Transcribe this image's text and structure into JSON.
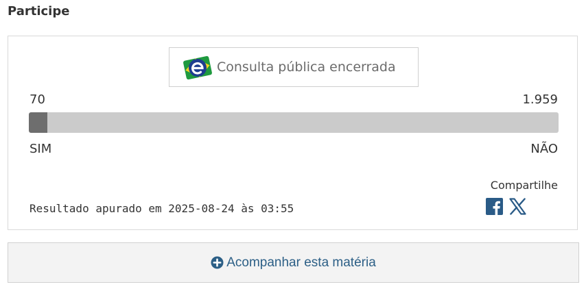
{
  "section": {
    "title": "Participe"
  },
  "consulta": {
    "status_text": "Consulta pública encerrada",
    "yes_count": "70",
    "no_count": "1.959",
    "yes_label": "SIM",
    "no_label": "NÃO",
    "yes_fraction": 0.0345,
    "result_text": "Resultado apurado em 2025-08-24 às 03:55"
  },
  "share": {
    "label": "Compartilhe",
    "icons": [
      "facebook-icon",
      "x-twitter-icon"
    ]
  },
  "follow": {
    "label": "Acompanhar esta matéria",
    "icon": "plus-circle-icon"
  },
  "colors": {
    "bar_track": "#cbcbcb",
    "bar_fill": "#6e6e6e",
    "link_blue": "#2c5f86",
    "facebook": "#2a5b87"
  }
}
